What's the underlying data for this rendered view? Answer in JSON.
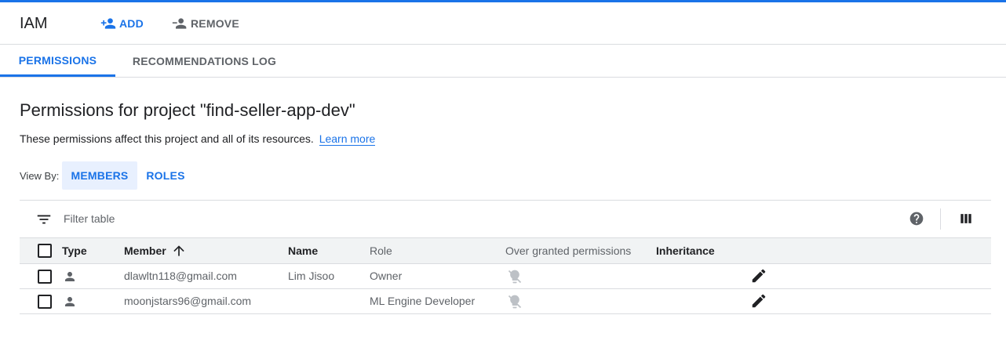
{
  "header": {
    "title": "IAM",
    "add_label": "ADD",
    "remove_label": "REMOVE"
  },
  "tabs": [
    {
      "label": "PERMISSIONS",
      "active": true
    },
    {
      "label": "RECOMMENDATIONS LOG",
      "active": false
    }
  ],
  "main": {
    "title": "Permissions for project \"find-seller-app-dev\"",
    "subtitle": "These permissions affect this project and all of its resources.",
    "learn_more": "Learn more",
    "view_by_label": "View By:",
    "view_by_options": [
      {
        "label": "MEMBERS",
        "selected": true
      },
      {
        "label": "ROLES",
        "selected": false
      }
    ]
  },
  "table": {
    "filter_placeholder": "Filter table",
    "columns": [
      "Type",
      "Member",
      "Name",
      "Role",
      "Over granted permissions",
      "Inheritance"
    ],
    "sort_column": "Member",
    "sort_direction": "ascending",
    "rows": [
      {
        "type": "person-icon",
        "member": "dlawltn118@gmail.com",
        "name": "Lim Jisoo",
        "role": "Owner"
      },
      {
        "type": "person-icon",
        "member": "moonjstars96@gmail.com",
        "name": "",
        "role": "ML Engine Developer"
      }
    ]
  },
  "colors": {
    "accent": "#1a73e8",
    "header_bg": "#f1f3f4",
    "selected_bg": "#e8f0fe"
  }
}
